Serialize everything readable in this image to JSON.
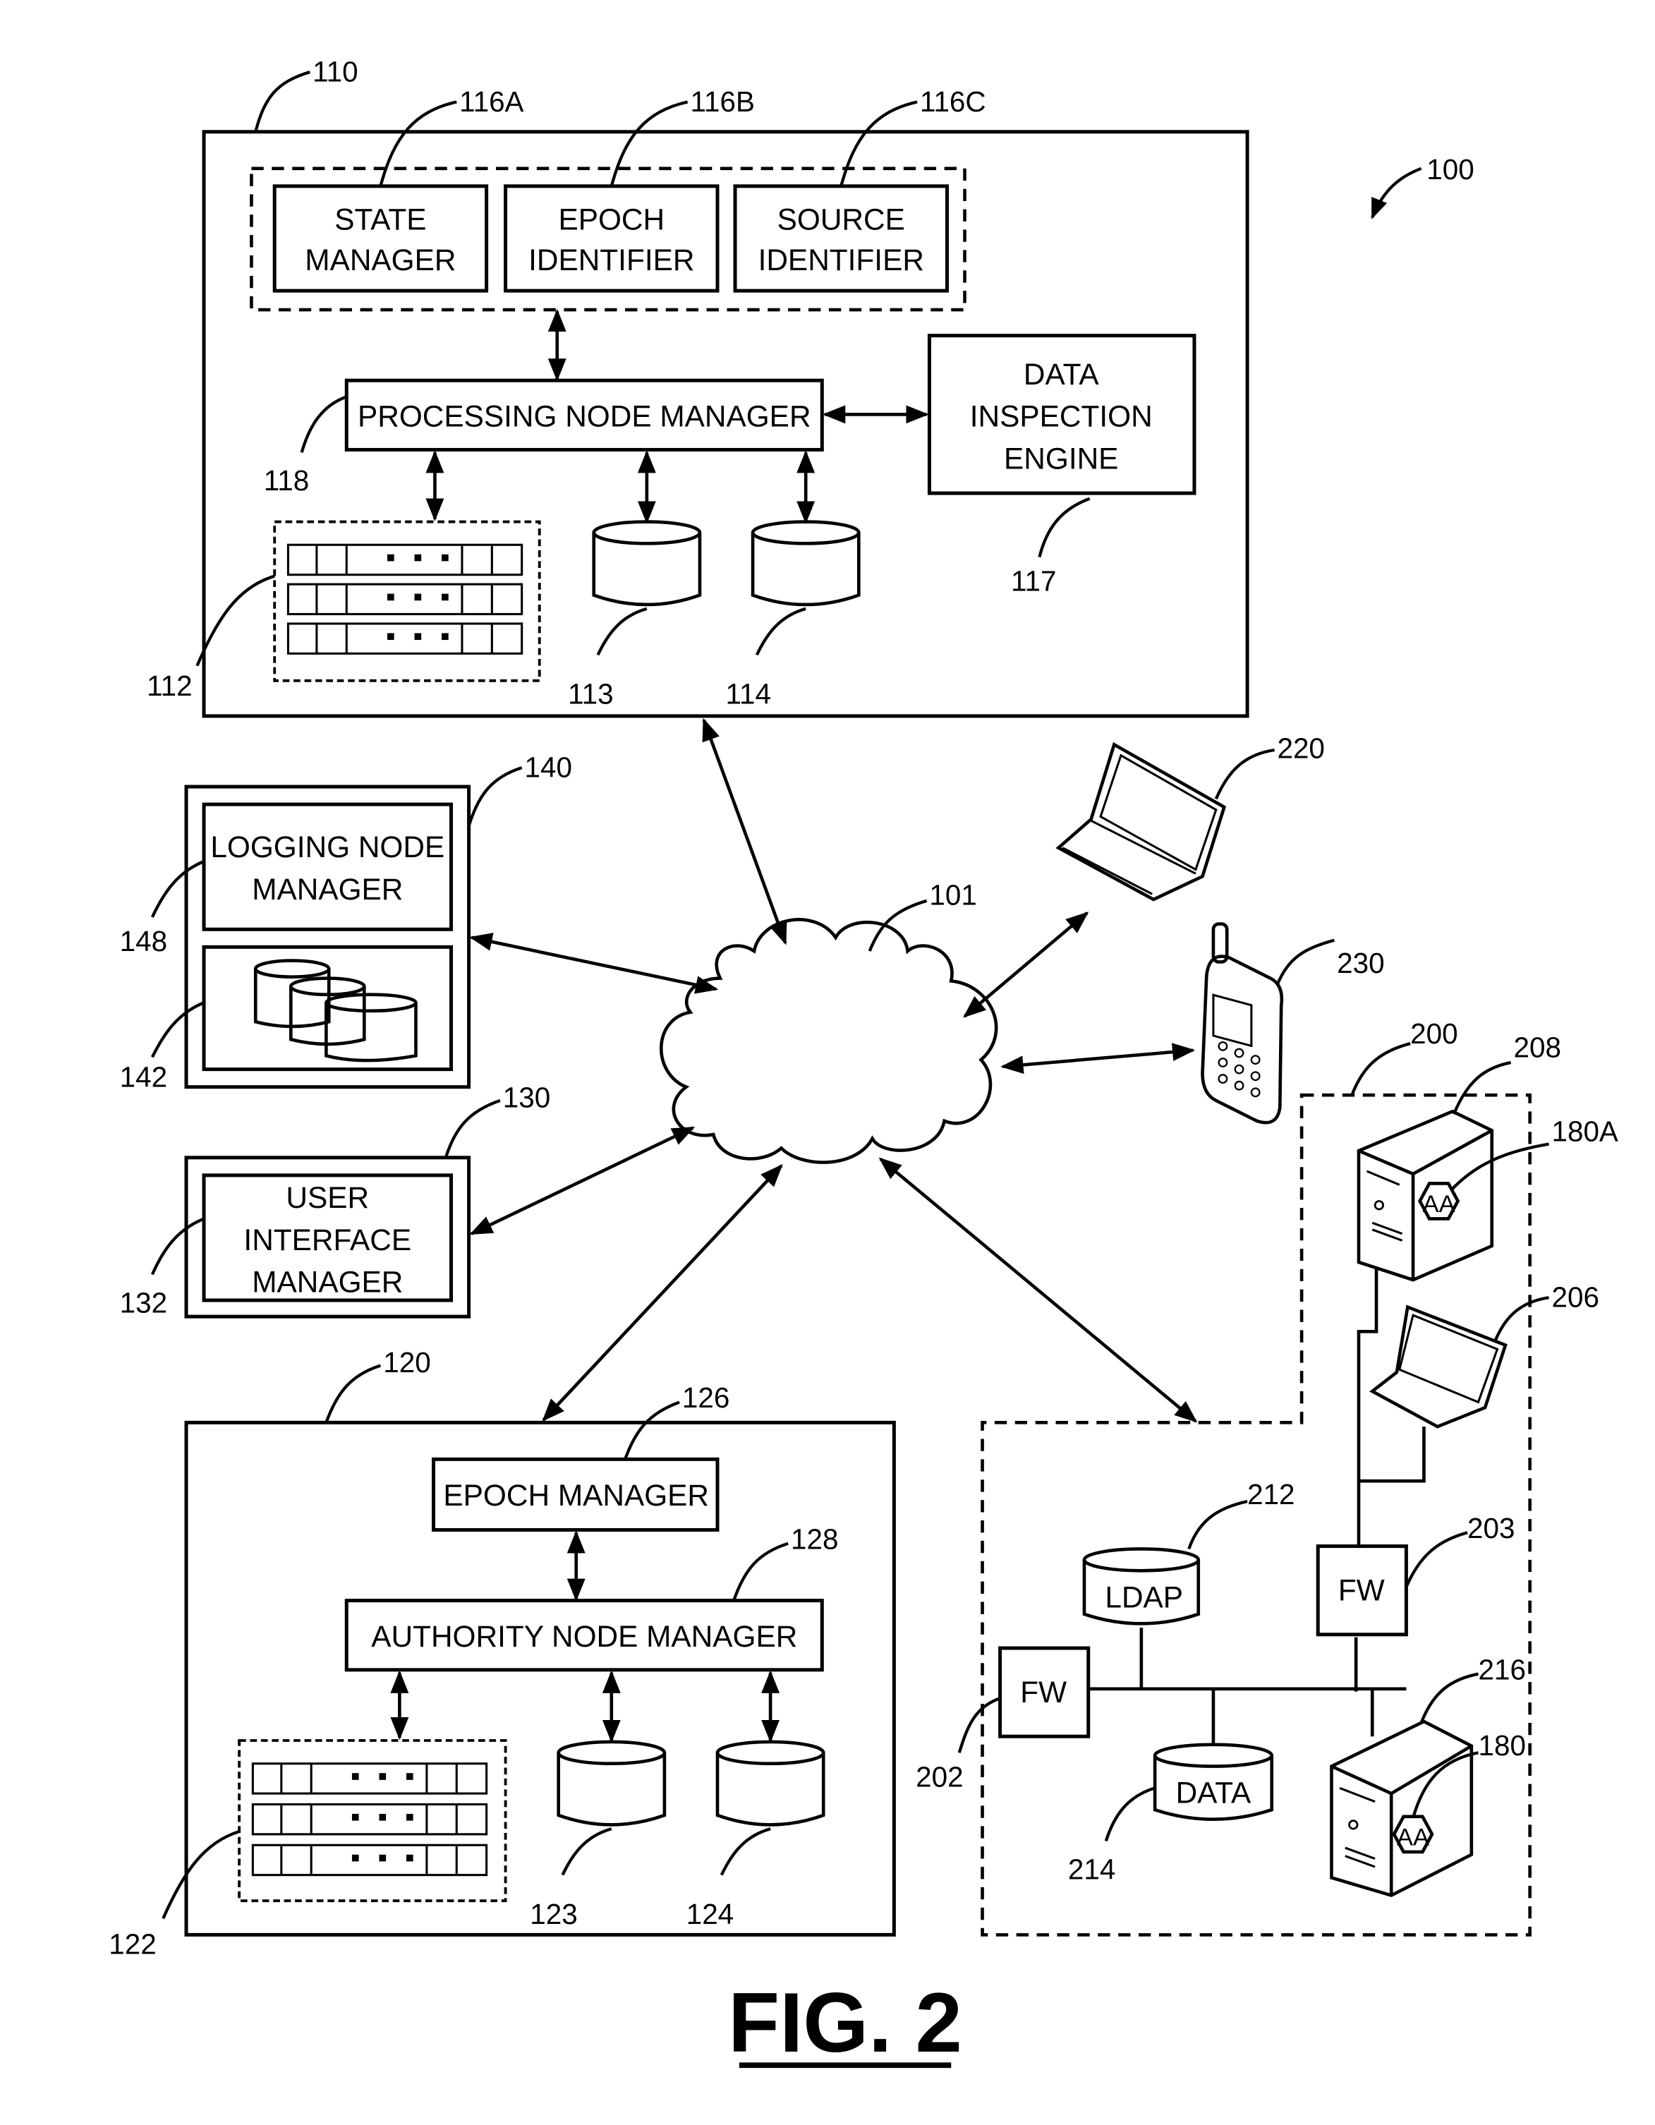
{
  "figure": {
    "title": "FIG. 2",
    "system_ref": "100",
    "network_ref": "101"
  },
  "processing_node": {
    "ref": "110",
    "state_manager": {
      "ref": "116A",
      "lines": [
        "STATE",
        "MANAGER"
      ]
    },
    "epoch_identifier": {
      "ref": "116B",
      "lines": [
        "EPOCH",
        "IDENTIFIER"
      ]
    },
    "source_identifier": {
      "ref": "116C",
      "lines": [
        "SOURCE",
        "IDENTIFIER"
      ]
    },
    "processing_node_manager": {
      "ref": "118",
      "label": "PROCESSING NODE MANAGER"
    },
    "data_inspection_engine": {
      "ref": "117",
      "lines": [
        "DATA",
        "INSPECTION",
        "ENGINE"
      ]
    },
    "server_rack": {
      "ref": "112"
    },
    "db_a": {
      "ref": "113"
    },
    "db_b": {
      "ref": "114"
    }
  },
  "logging_node": {
    "ref": "140",
    "logging_node_manager": {
      "ref": "148",
      "lines": [
        "LOGGING NODE",
        "MANAGER"
      ]
    },
    "storage": {
      "ref": "142"
    }
  },
  "user_interface_node": {
    "ref": "130",
    "user_interface_manager": {
      "ref": "132",
      "lines": [
        "USER",
        "INTERFACE",
        "MANAGER"
      ]
    }
  },
  "authority_node": {
    "ref": "120",
    "epoch_manager": {
      "ref": "126",
      "label": "EPOCH MANAGER"
    },
    "authority_node_manager": {
      "ref": "128",
      "label": "AUTHORITY NODE MANAGER"
    },
    "server_rack": {
      "ref": "122"
    },
    "db_a": {
      "ref": "123"
    },
    "db_b": {
      "ref": "124"
    }
  },
  "client_devices": {
    "laptop": {
      "ref": "220"
    },
    "phone": {
      "ref": "230"
    }
  },
  "enterprise_network": {
    "ref": "200",
    "server_top": {
      "ref": "208",
      "agent_ref": "180A",
      "agent_label": "AA"
    },
    "laptop": {
      "ref": "206"
    },
    "firewall_a": {
      "ref": "202",
      "label": "FW"
    },
    "firewall_b": {
      "ref": "203",
      "label": "FW"
    },
    "ldap": {
      "ref": "212",
      "label": "LDAP"
    },
    "data_store": {
      "ref": "214",
      "label": "DATA"
    },
    "server_bottom": {
      "ref": "216",
      "agent_ref": "180",
      "agent_label": "AA"
    }
  }
}
